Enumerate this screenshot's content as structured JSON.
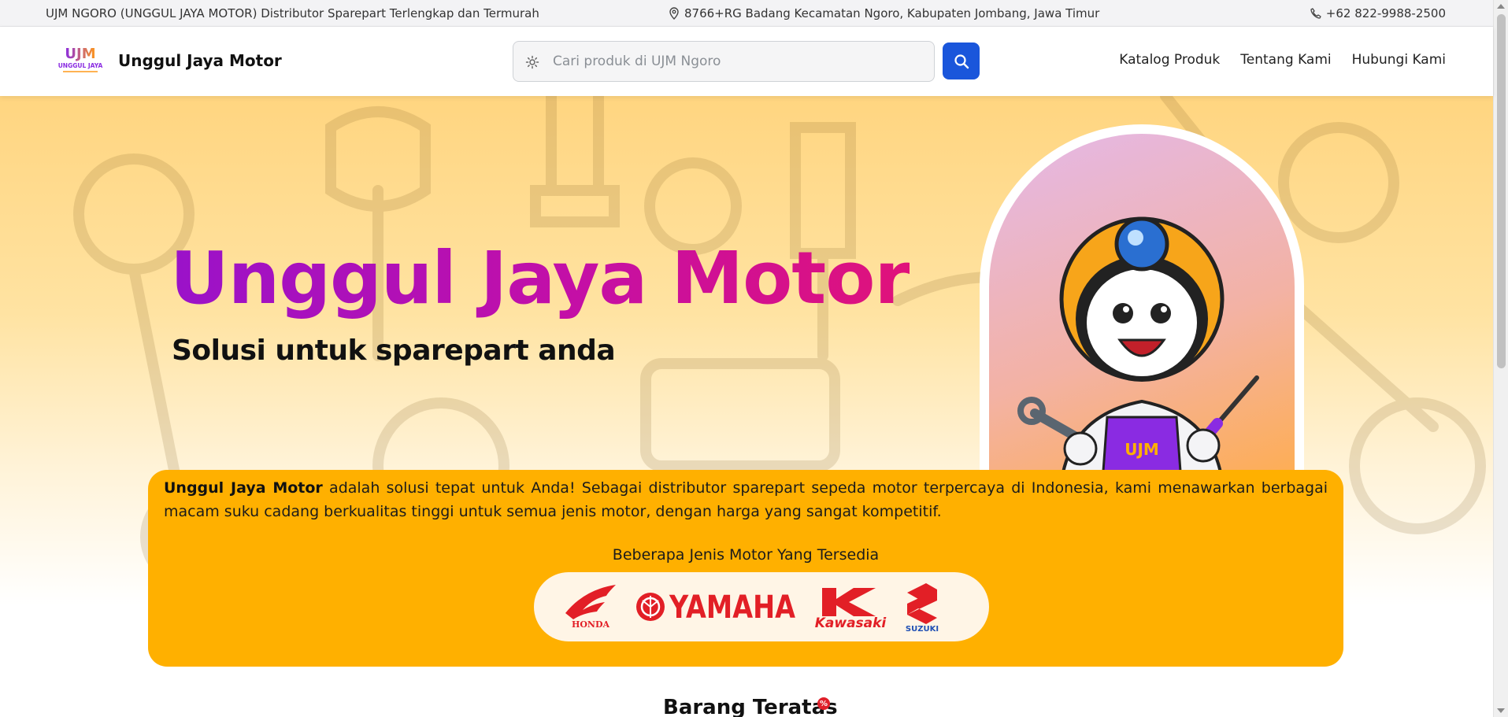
{
  "topbar": {
    "tagline": "UJM NGORO (UNGGUL JAYA MOTOR) Distributor Sparepart Terlengkap dan Termurah",
    "address": "8766+RG Badang Kecamatan Ngoro, Kabupaten Jombang, Jawa Timur",
    "phone": "+62 822-9988-2500"
  },
  "header": {
    "logo_text": "UJM",
    "logo_subtext": "UNGGUL JAYA",
    "brand": "Unggul Jaya Motor",
    "search_placeholder": "Cari produk di UJM Ngoro",
    "nav": [
      {
        "label": "Katalog Produk"
      },
      {
        "label": "Tentang Kami"
      },
      {
        "label": "Hubungi Kami"
      }
    ]
  },
  "hero": {
    "title": "Unggul Jaya Motor",
    "subtitle": "Solusi untuk sparepart anda",
    "mascot_badge": "UJM"
  },
  "about": {
    "brand_bold": "Unggul Jaya Motor",
    "text": " adalah solusi tepat untuk Anda! Sebagai distributor sparepart sepeda motor terpercaya di Indonesia, kami menawarkan berbagai macam suku cadang berkualitas tinggi untuk semua jenis motor, dengan harga yang sangat kompetitif.",
    "types_label": "Beberapa Jenis Motor Yang Tersedia",
    "brands": [
      {
        "name": "HONDA",
        "icon": "honda-wing-icon"
      },
      {
        "name": "YAMAHA",
        "icon": "yamaha-tuning-fork-icon"
      },
      {
        "name": "Kawasaki",
        "icon": "kawasaki-k-icon"
      },
      {
        "name": "SUZUKI",
        "icon": "suzuki-s-icon"
      }
    ]
  },
  "section": {
    "title": "Barang Teratas",
    "badge": "%"
  },
  "colors": {
    "primary_blue": "#1a56db",
    "card_orange": "#ffb000",
    "title_gradient_start": "#9a12c9",
    "title_gradient_end": "#e0127a",
    "brand_red": "#e21f26"
  }
}
